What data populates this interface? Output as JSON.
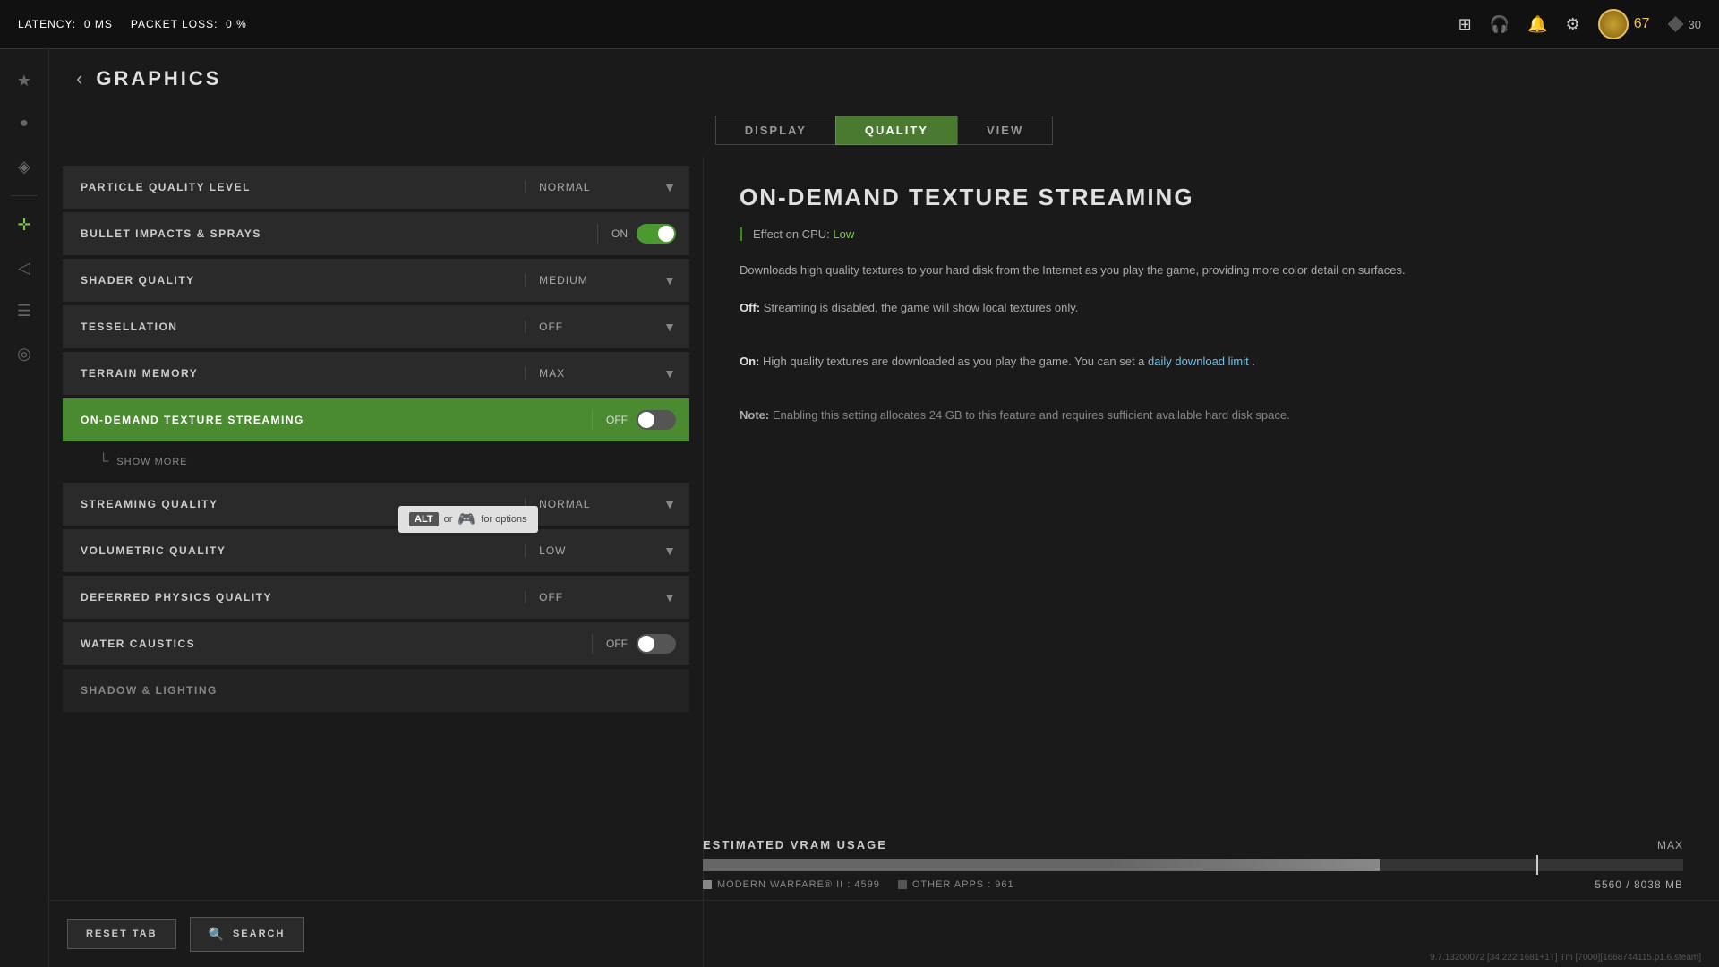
{
  "latency": {
    "label": "LATENCY:",
    "value": "0 MS",
    "packet_loss_label": "PACKET LOSS:",
    "packet_loss_value": "0 %"
  },
  "topbar": {
    "icons": [
      "grid-icon",
      "headphones-icon",
      "bell-icon",
      "settings-icon"
    ],
    "user_level": "67",
    "token_count": "30"
  },
  "page": {
    "title": "GRAPHICS"
  },
  "tabs": [
    {
      "id": "display",
      "label": "DISPLAY",
      "active": false
    },
    {
      "id": "quality",
      "label": "QUALITY",
      "active": true
    },
    {
      "id": "view",
      "label": "VIEW",
      "active": false
    }
  ],
  "settings": [
    {
      "id": "particle-quality",
      "label": "PARTICLE QUALITY LEVEL",
      "value": "NORMAL",
      "type": "dropdown"
    },
    {
      "id": "bullet-impacts",
      "label": "BULLET IMPACTS & SPRAYS",
      "value": "ON",
      "type": "toggle",
      "toggle_on": true
    },
    {
      "id": "shader-quality",
      "label": "SHADER QUALITY",
      "value": "MEDIUM",
      "type": "dropdown"
    },
    {
      "id": "tessellation",
      "label": "TESSELLATION",
      "value": "OFF",
      "type": "dropdown"
    },
    {
      "id": "terrain-memory",
      "label": "TERRAIN MEMORY",
      "value": "MAX",
      "type": "dropdown"
    },
    {
      "id": "on-demand-texture",
      "label": "ON-DEMAND TEXTURE STREAMING",
      "value": "OFF",
      "type": "toggle",
      "toggle_on": false,
      "active": true
    },
    {
      "id": "streaming-quality",
      "label": "STREAMING QUALITY",
      "value": "NORMAL",
      "type": "dropdown"
    },
    {
      "id": "volumetric-quality",
      "label": "VOLUMETRIC QUALITY",
      "value": "LOW",
      "type": "dropdown"
    },
    {
      "id": "deferred-physics",
      "label": "DEFERRED PHYSICS QUALITY",
      "value": "OFF",
      "type": "dropdown"
    },
    {
      "id": "water-caustics",
      "label": "WATER CAUSTICS",
      "value": "OFF",
      "type": "toggle",
      "toggle_on": false
    },
    {
      "id": "shadow-lighting",
      "label": "SHADOW & LIGHTING",
      "value": "",
      "type": "section"
    }
  ],
  "show_more": {
    "label": "SHOW MORE"
  },
  "tooltip": {
    "alt_key": "ALT",
    "or_text": "or",
    "controller_text": "for options"
  },
  "info_panel": {
    "title": "ON-DEMAND TEXTURE STREAMING",
    "cpu_label": "Effect on CPU:",
    "cpu_value": "Low",
    "description_1": "Downloads high quality textures to your hard disk from the Internet as you play the game, providing more color detail on surfaces.",
    "off_label": "Off:",
    "off_text": " Streaming is disabled, the game will show local textures only.",
    "on_label": "On:",
    "on_text": " High quality textures are downloaded as you play the game. You can set a ",
    "download_link": "daily download limit",
    "on_text_end": ".",
    "note_prefix": "Note:",
    "note_text": " Enabling this setting allocates 24 GB to this feature and requires sufficient available hard disk space."
  },
  "vram": {
    "title": "ESTIMATED VRAM USAGE",
    "max_label": "MAX",
    "game_label": "MODERN WARFARE® II : 4599",
    "other_label": "OTHER APPS : 961",
    "total": "5560 / 8038 MB",
    "fill_percent": 69,
    "marker_percent": 85
  },
  "bottom_bar": {
    "reset_label": "RESET TAB",
    "search_label": "SEARCH"
  },
  "version": "9.7.13200072 [34:222:1681+1T] Tm [7000][1668744115.p1.6.steam]",
  "sidebar_icons": [
    {
      "id": "star",
      "symbol": "★",
      "active": false
    },
    {
      "id": "user",
      "symbol": "👤",
      "active": false
    },
    {
      "id": "controller",
      "symbol": "🎮",
      "active": false
    },
    {
      "id": "crosshair",
      "symbol": "✛",
      "active": true
    },
    {
      "id": "audio",
      "symbol": "🔊",
      "active": false
    },
    {
      "id": "account",
      "symbol": "⊞",
      "active": false
    },
    {
      "id": "network",
      "symbol": "📡",
      "active": false
    }
  ]
}
